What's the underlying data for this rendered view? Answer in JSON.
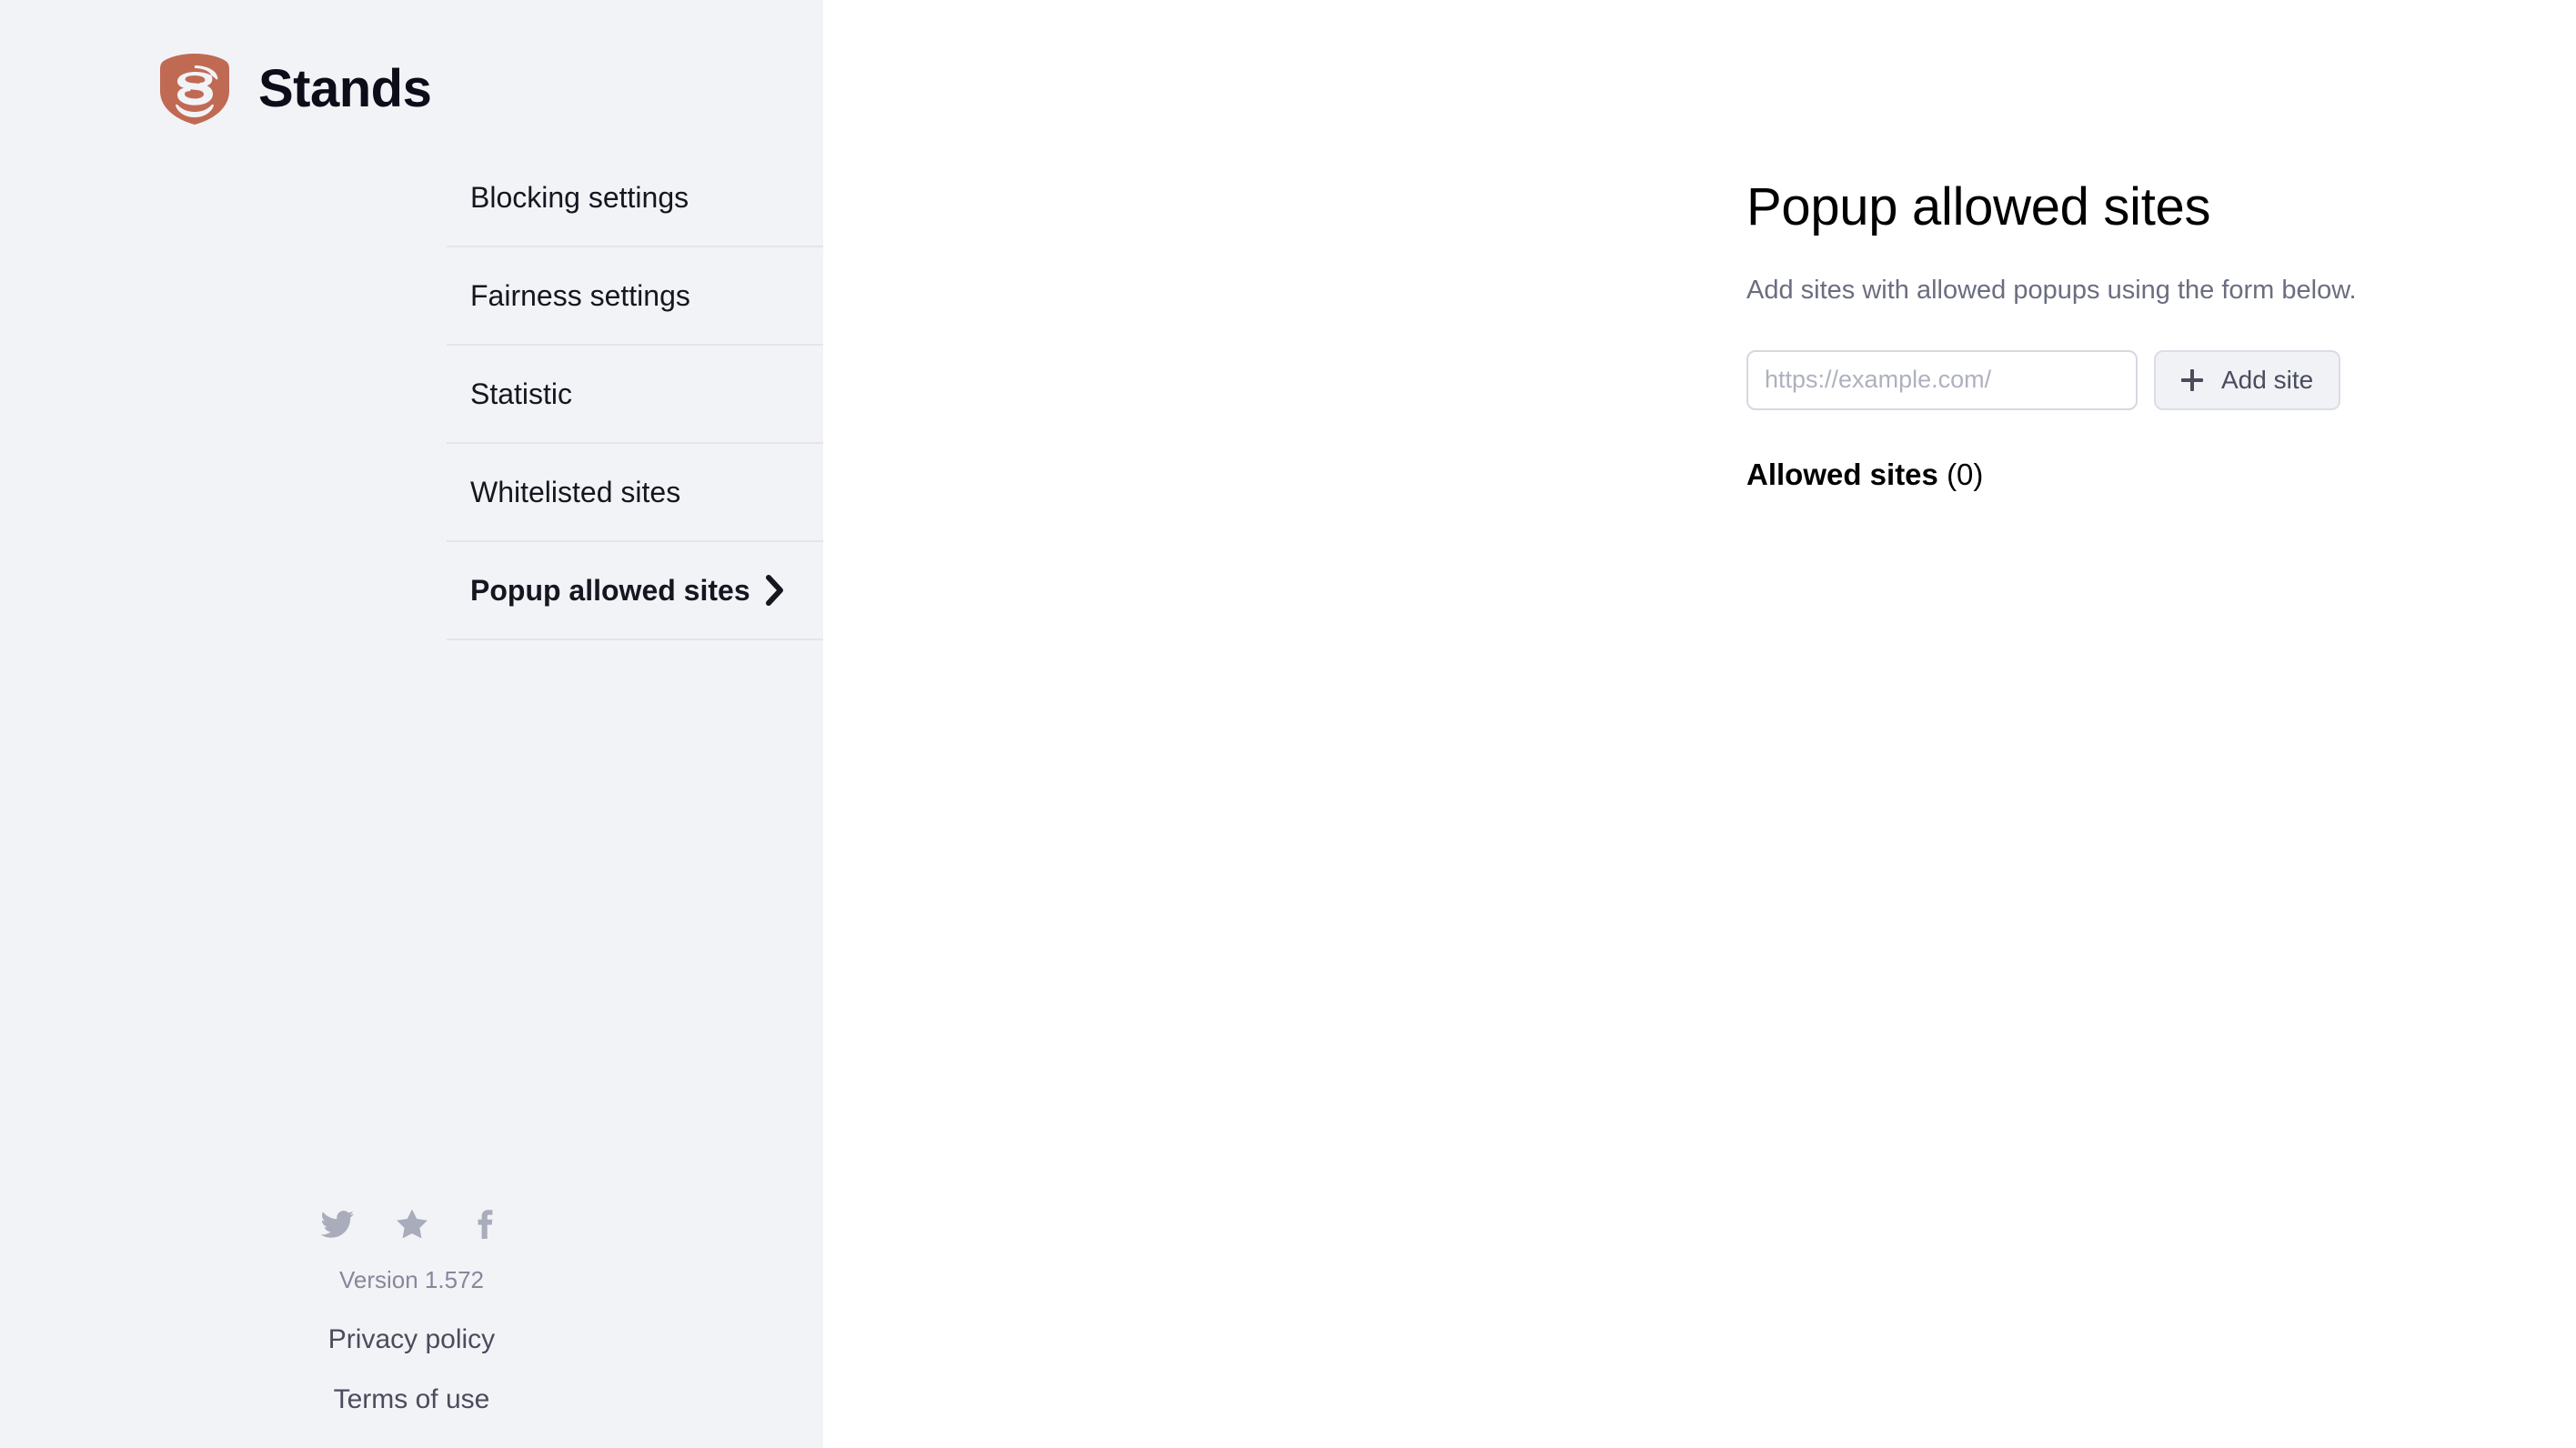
{
  "brand": {
    "name": "Stands",
    "logo_icon": "shield-s-logo",
    "logo_color": "#c06a54"
  },
  "sidebar": {
    "nav_items": [
      {
        "label": "Blocking settings",
        "active": false
      },
      {
        "label": "Fairness settings",
        "active": false
      },
      {
        "label": "Statistic",
        "active": false
      },
      {
        "label": "Whitelisted sites",
        "active": false
      },
      {
        "label": "Popup allowed sites",
        "active": true,
        "chevron_icon": "chevron-right-icon"
      }
    ],
    "footer": {
      "social": [
        {
          "icon": "twitter-icon",
          "name": "twitter"
        },
        {
          "icon": "star-icon",
          "name": "rate-us"
        },
        {
          "icon": "facebook-icon",
          "name": "facebook"
        }
      ],
      "version": "Version 1.572",
      "links": [
        {
          "label": "Privacy policy"
        },
        {
          "label": "Terms of use"
        }
      ]
    }
  },
  "main": {
    "title": "Popup allowed sites",
    "subtitle": "Add sites with allowed popups using the form below.",
    "form": {
      "input_value": "",
      "input_placeholder": "https://example.com/",
      "add_button_label": "Add site",
      "add_button_icon": "plus-icon"
    },
    "allowed_sites": {
      "heading": "Allowed sites",
      "count": "(0)",
      "items": []
    }
  },
  "colors": {
    "sidebar_bg": "#f2f3f7",
    "main_bg": "#ffffff",
    "divider": "#e3e5eb",
    "brand_accent": "#c06a54",
    "muted_text": "#6b6e80"
  }
}
